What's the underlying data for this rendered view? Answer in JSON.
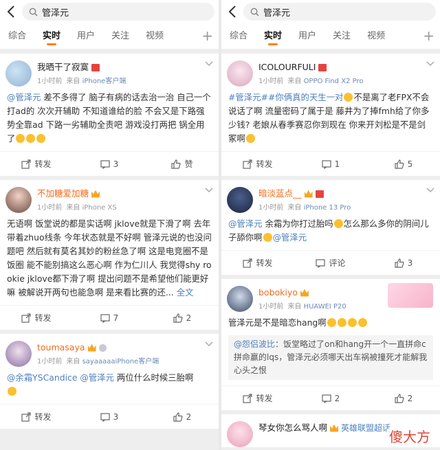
{
  "left": {
    "search": {
      "query": "管泽元"
    },
    "tabs": [
      "综合",
      "实时",
      "用户",
      "关注",
      "视频"
    ],
    "active_tab": "实时",
    "posts": [
      {
        "user": "我晒干了寂寞",
        "time": "1小时前",
        "source_prefix": "来自",
        "device": "iPhone客户端",
        "mention": "@管泽元",
        "text": " 差不多得了 脑子有病的话去治一治 自己一个打ad的 次次开辅助 不知道谁给的脸 不会又是下路强势全靠ad 下路一劣辅助全责吧 游戏没打两把 锅全用了",
        "repost_label": "转发",
        "comments": "3",
        "likes_label": "赞"
      },
      {
        "user": "不加糖爱加糖",
        "time": "1小时前",
        "source_prefix": "来自",
        "device": "iPhone XS",
        "text": "无语啊 饭堂说的都是实话啊 jklove就是下滑了啊 去年带着zhuo线条 今年状态就是不好啊 管泽元说的也没问题吧 然后就有莫名其妙的粉丝急了啊 这是电竞圈不是饭圈 能不能别搞这么恶心啊 作为仁川人 我觉得shy rookie jklove都下滑了啊 提出问题不是希望他们能更好嘛 被解说开两句也能急啊 是来看比赛的还...",
        "more": "全文",
        "repost_label": "转发",
        "comments": "7",
        "likes": "2"
      },
      {
        "user": "toumasaya",
        "time": "1小时前",
        "source_prefix": "来自",
        "device": "sayaaaaaiPhone客户端",
        "mention1": "@余霜YSCandice",
        "mention2": "@管泽元",
        "text": " 两位什么时候三胎啊",
        "repost_label": "转发",
        "comments": "3",
        "likes": "2"
      }
    ]
  },
  "right": {
    "search": {
      "query": "管泽元"
    },
    "tabs": [
      "综合",
      "实时",
      "用户",
      "关注",
      "视频"
    ],
    "active_tab": "实时",
    "posts": [
      {
        "user": "ICOLOURFULI",
        "time": "1小时前",
        "source_prefix": "来自",
        "device": "OPPO Find X2 Pro",
        "topic1": "#管泽元#",
        "topic2": "#你俩真的天生一对",
        "text": "不是离了老FPX不会说话了啊 流量密码了属于是 藤井为了捧fmh给了你多少钱? 老娘从春季赛忍你到现在 你来开刘松是不是剑冢啊",
        "repost_label": "转发",
        "comments": "1",
        "likes": "5"
      },
      {
        "user": "暗淡蓝点__",
        "time": "1小时前",
        "source_prefix": "来自",
        "device": "iPhone 13 Pro",
        "mention1": "@管泽元",
        "text1": " 余霜为你打过胎吗",
        "text2": "怎么那么多你的阴间儿子舔你啊",
        "mention2": "@管泽元",
        "repost_label": "转发",
        "comments_label": "评论",
        "likes": "3"
      },
      {
        "user": "bobokiyo",
        "time": "1小时前",
        "source_prefix": "来自",
        "device": "HUAWEI P20",
        "text": "管泽元是不是暗恋hang啊",
        "quote_mention": "@怨侣波比",
        "quote_text": "：饭堂略过了on和hang开一个一直拼命c拼命赢的lqs，管泽元必须哪天出车祸被撞死才能解我心头之恨",
        "repost_label": "转发",
        "comments": "2",
        "likes": "2"
      },
      {
        "user": "琴女你怎么骂人啊",
        "topic": "英雄联盟超话"
      }
    ]
  },
  "watermark": "傻大方"
}
